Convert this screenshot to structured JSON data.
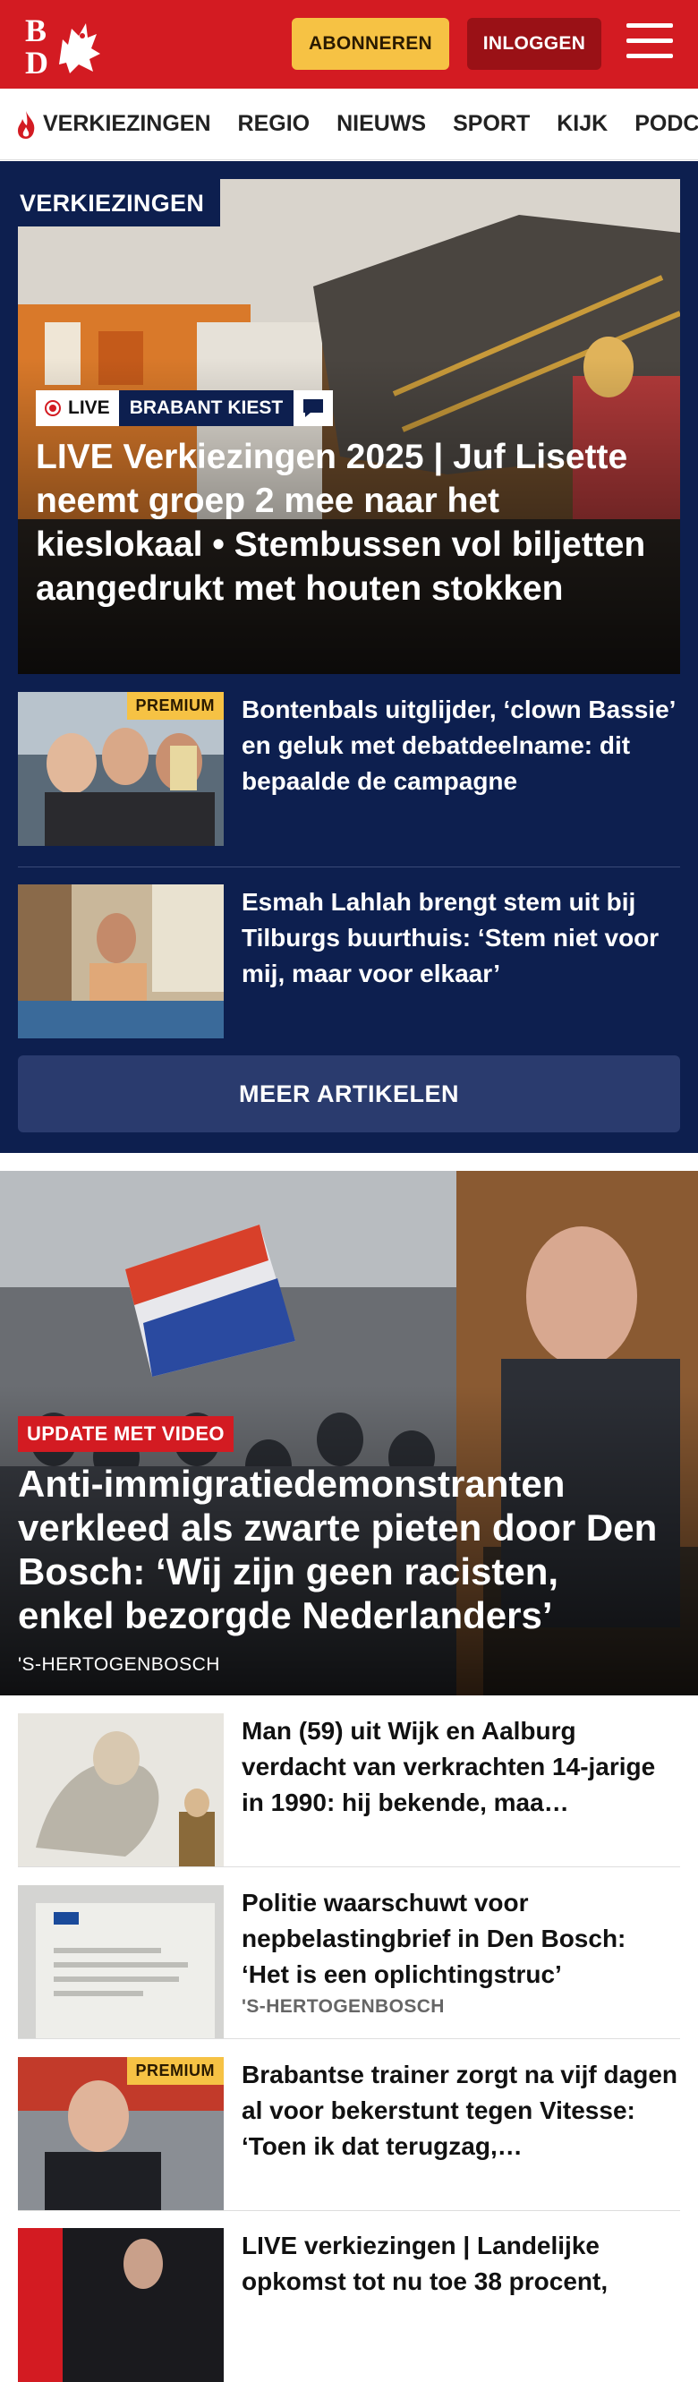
{
  "header": {
    "logo_text": "BD",
    "subscribe_label": "ABONNEREN",
    "login_label": "INLOGGEN",
    "brand_color": "#d31b22",
    "accent_color": "#f6c244"
  },
  "nav": {
    "items": [
      "VERKIEZINGEN",
      "REGIO",
      "NIEUWS",
      "SPORT",
      "KIJK",
      "PODCAST"
    ]
  },
  "elections": {
    "section_label": "VERKIEZINGEN",
    "hero": {
      "live_label": "LIVE",
      "tag_label": "BRABANT KIEST",
      "title": "LIVE Verkiezingen 2025 | Juf Lisette neemt groep 2 mee naar het kieslokaal • Stembussen vol biljetten aangedrukt met houten stokken"
    },
    "articles": [
      {
        "title": "Bontenbals uitglijder, ‘clown Bassie’ en geluk met debatdeelna­me: dit bepaalde de campagne",
        "premium": "PREMIUM"
      },
      {
        "title": "Esmah Lahlah brengt stem uit bij Tilburgs buurthuis: ‘Stem niet voor mij, maar voor elkaar’"
      }
    ],
    "more_label": "MEER ARTIKELEN",
    "background_color": "#0d1f4f"
  },
  "lead": {
    "badge": "UPDATE MET VIDEO",
    "title": "Anti-immigratiedemonstranten verkleed als zwarte pieten door Den Bosch: ‘Wij zijn geen racisten, enkel bezorgde Nederlanders’",
    "location": "'S-HERTOGENBOSCH"
  },
  "list": [
    {
      "title": "Man (59) uit Wijk en Aalburg verdacht van verkrachten 14-jarige in 1990: hij bekende, maa…",
      "location": ""
    },
    {
      "title": "Politie waarschuwt voor nepbelastingbrief in Den Bosch: ‘Het is een oplichtingstruc’",
      "location": "'S-HERTOGENBOSCH"
    },
    {
      "title": "Brabantse trainer zorgt na vijf dagen al voor bekerstunt tegen Vitesse: ‘Toen ik dat terugzag,…",
      "location": "",
      "premium": "PREMIUM"
    },
    {
      "title": "LIVE verkiezingen | Landelijke opkomst tot nu toe 38 procent,",
      "location": ""
    }
  ]
}
